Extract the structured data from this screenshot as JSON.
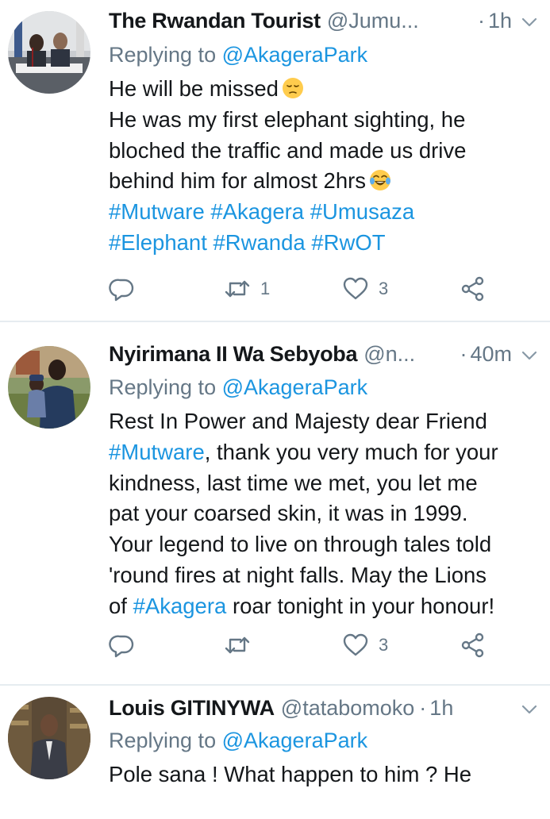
{
  "tweets": [
    {
      "name": "The Rwandan Tourist",
      "handle": "@Jumu...",
      "dot": "·",
      "time": "1h",
      "replying_label": "Replying to",
      "replying_to": "@AkageraPark",
      "lines": {
        "l1": "He will be missed",
        "l2": "He was my first elephant sighting, he",
        "l3": "bloched the traffic and made us drive",
        "l4": "behind him for almost 2hrs",
        "l5": "#Mutware #Akagera #Umusaza",
        "l6": "#Elephant #Rwanda #RwOT"
      },
      "emoji_1": "pensive-face-emoji",
      "emoji_2": "tears-of-joy-emoji",
      "retweets": "1",
      "likes": "3"
    },
    {
      "name": "Nyirimana II Wa Sebyoba",
      "handle": "@n...",
      "dot": "·",
      "time": "40m",
      "replying_label": "Replying to",
      "replying_to": "@AkageraPark",
      "lines": {
        "l1": "Rest In Power and Majesty dear Friend",
        "l2_tag": "#Mutware",
        "l2_rest": ", thank you very much for your",
        "l3": "kindness, last time we met, you let me",
        "l4": "pat your coarsed skin, it was in 1999.",
        "l5": "Your legend to live on through tales told",
        "l6": "'round fires at night falls. May the Lions",
        "l7_pre": "of ",
        "l7_tag": "#Akagera",
        "l7_rest": " roar tonight in your honour!"
      },
      "retweets": "",
      "likes": "3"
    },
    {
      "name": "Louis GITINYWA",
      "handle": "@tatabomoko",
      "dot": "·",
      "time": "1h",
      "replying_label": "Replying to",
      "replying_to": "@AkageraPark",
      "lines": {
        "l1": "Pole sana ! What happen to him ? He"
      }
    }
  ],
  "icons": {
    "reply": "reply-icon",
    "retweet": "retweet-icon",
    "like": "heart-icon",
    "share": "share-icon",
    "menu": "chevron-down-icon"
  },
  "colors": {
    "link": "#1b95e0",
    "secondary": "#657786",
    "text": "#14171a",
    "divider": "#e6ecf0"
  }
}
